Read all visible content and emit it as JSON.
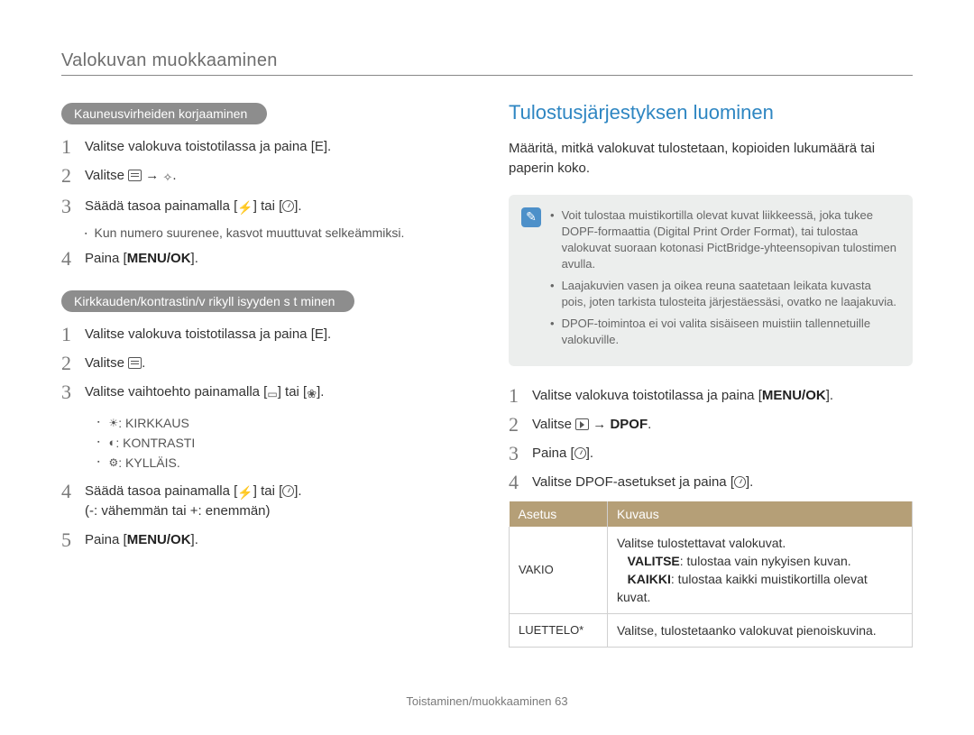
{
  "header": {
    "section_title": "Valokuvan muokkaaminen"
  },
  "left": {
    "pill1": "Kauneusvirheiden korjaaminen",
    "s1": {
      "n1": "1",
      "t1": "Valitse valokuva toistotilassa ja paina [E].",
      "n2": "2",
      "t2_pre": "Valitse",
      "t2_mid": "→",
      "n3": "3",
      "t3_pre": "Säädä tasoa painamalla [",
      "t3_mid": "] tai [",
      "t3_post": "].",
      "sub3": "Kun numero suurenee, kasvot muuttuvat selkeämmiksi.",
      "n4": "4",
      "t4_pre": "Paina [",
      "t4_btn": "MENU/OK",
      "t4_post": "]."
    },
    "pill2": "Kirkkauden/kontrastin/v rikyll isyyden s t minen",
    "s2": {
      "n1": "1",
      "t1": "Valitse valokuva toistotilassa ja paina [E].",
      "n2": "2",
      "t2_pre": "Valitse",
      "n3": "3",
      "t3_pre": "Valitse vaihtoehto painamalla [",
      "t3_mid": "] tai [",
      "t3_post": "].",
      "opts": [
        {
          "name": ": KIRKKAUS"
        },
        {
          "name": ": KONTRASTI"
        },
        {
          "name": ": KYLLÄIS."
        }
      ],
      "n4": "4",
      "t4_pre": "Säädä tasoa painamalla [",
      "t4_mid": "] tai [",
      "t4_post": "].",
      "t4_note": "(-: vähemmän tai +: enemmän)",
      "n5": "5",
      "t5_pre": "Paina [",
      "t5_btn": "MENU/OK",
      "t5_post": "]."
    }
  },
  "right": {
    "heading": "Tulostusjärjestyksen luominen",
    "intro": "Määritä, mitkä valokuvat tulostetaan, kopioiden lukumäärä tai paperin koko.",
    "notes": [
      "Voit tulostaa muistikortilla olevat kuvat liikkeessä, joka tukee DOPF-formaattia (Digital Print Order Format), tai tulostaa valokuvat suoraan kotonasi PictBridge-yhteensopivan tulostimen avulla.",
      "Laajakuvien vasen ja oikea reuna saatetaan leikata kuvasta pois, joten tarkista tulosteita järjestäessäsi, ovatko ne laajakuvia.",
      "DPOF-toimintoa ei voi valita sisäiseen muistiin tallennetuille valokuville."
    ],
    "s": {
      "n1": "1",
      "t1_pre": "Valitse valokuva toistotilassa ja paina [",
      "t1_btn": "MENU/OK",
      "t1_post": "].",
      "n2": "2",
      "t2_pre": "Valitse",
      "t2_arrow": "→",
      "t2_dpof": "DPOF",
      "t2_post": ".",
      "n3": "3",
      "t3_pre": "Paina [",
      "t3_post": "].",
      "n4": "4",
      "t4_pre": "Valitse DPOF-asetukset ja paina [",
      "t4_post": "]."
    },
    "table": {
      "h1": "Asetus",
      "h2": "Kuvaus",
      "rows": [
        {
          "c1": "VAKIO",
          "c2_line1": "Valitse tulostettavat valokuvat.",
          "c2_b1_label": "VALITSE",
          "c2_b1_txt": ": tulostaa vain nykyisen kuvan.",
          "c2_b2_label": "KAIKKI",
          "c2_b2_txt": ": tulostaa kaikki muistikortilla olevat kuvat."
        },
        {
          "c1": "LUETTELO*",
          "c2": "Valitse, tulostetaanko valokuvat pienoiskuvina."
        }
      ]
    }
  },
  "footer": {
    "text": "Toistaminen/muokkaaminen  63"
  }
}
